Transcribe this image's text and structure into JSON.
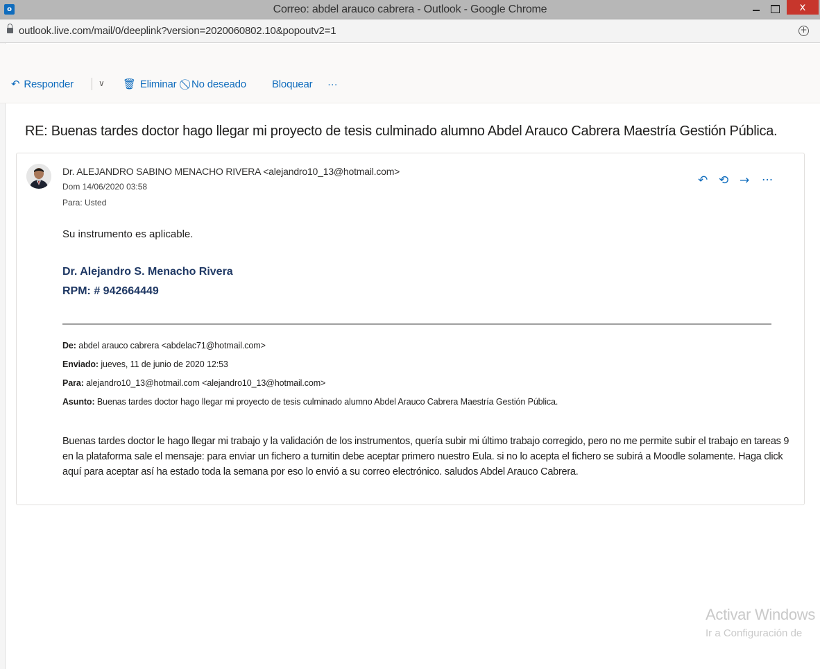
{
  "window": {
    "title": "Correo: abdel arauco cabrera - Outlook - Google Chrome",
    "logo_text": "o",
    "close_glyph": "x"
  },
  "address": {
    "url": "outlook.live.com/mail/0/deeplink?version=2020060802.10&popoutv2=1"
  },
  "toolbar": {
    "reply_label": "Responder",
    "delete_label": "Eliminar",
    "junk_label": "No deseado",
    "block_label": "Bloquear",
    "more_label": "···"
  },
  "message": {
    "subject": "RE: Buenas tardes doctor hago llegar mi proyecto de tesis culminado alumno Abdel Arauco Cabrera Maestría Gestión Pública.",
    "sender": "Dr. ALEJANDRO SABINO MENACHO RIVERA <alejandro10_13@hotmail.com>",
    "date": "Dom 14/06/2020 03:58",
    "to": "Para:  Usted",
    "body": "Su instrumento es aplicable.",
    "signature_name": "Dr. Alejandro S. Menacho Rivera",
    "signature_rpm": "RPM: # 942664449",
    "more_actions": "···"
  },
  "original": {
    "from_label": "De:",
    "from_value": " abdel arauco cabrera <abdelac71@hotmail.com>",
    "sent_label": "Enviado:",
    "sent_value": " jueves, 11 de junio de 2020 12:53",
    "to_label": "Para:",
    "to_value": " alejandro10_13@hotmail.com <alejandro10_13@hotmail.com>",
    "subject_label": "Asunto:",
    "subject_value": " Buenas tardes doctor hago llegar mi proyecto de tesis culminado alumno Abdel Arauco Cabrera Maestría Gestión Pública.",
    "body": "Buenas tardes doctor le hago llegar mi trabajo y la validación de los instrumentos, quería subir mi último trabajo corregido, pero no me permite subir el trabajo en tareas 9 en la plataforma sale el mensaje: para enviar un fichero a turnitin debe aceptar primero nuestro Eula. si no lo acepta el fichero se subirá a Moodle solamente. Haga click aquí para aceptar así ha estado toda la semana por eso lo envió a su correo electrónico. saludos Abdel Arauco Cabrera."
  },
  "watermark": {
    "line1": "Activar Windows",
    "line2": "Ir a Configuración de"
  },
  "icons": {
    "app": "outlook-logo-icon",
    "lock": "lock-icon",
    "zoom": "zoom-icon",
    "reply": "reply-icon",
    "delete": "trash-icon",
    "junk": "block-circle-icon",
    "reply_all": "reply-all-icon",
    "forward": "forward-icon"
  },
  "colors": {
    "accent": "#0f6cbd",
    "signature": "#1f3864",
    "close_button": "#c7362c"
  }
}
